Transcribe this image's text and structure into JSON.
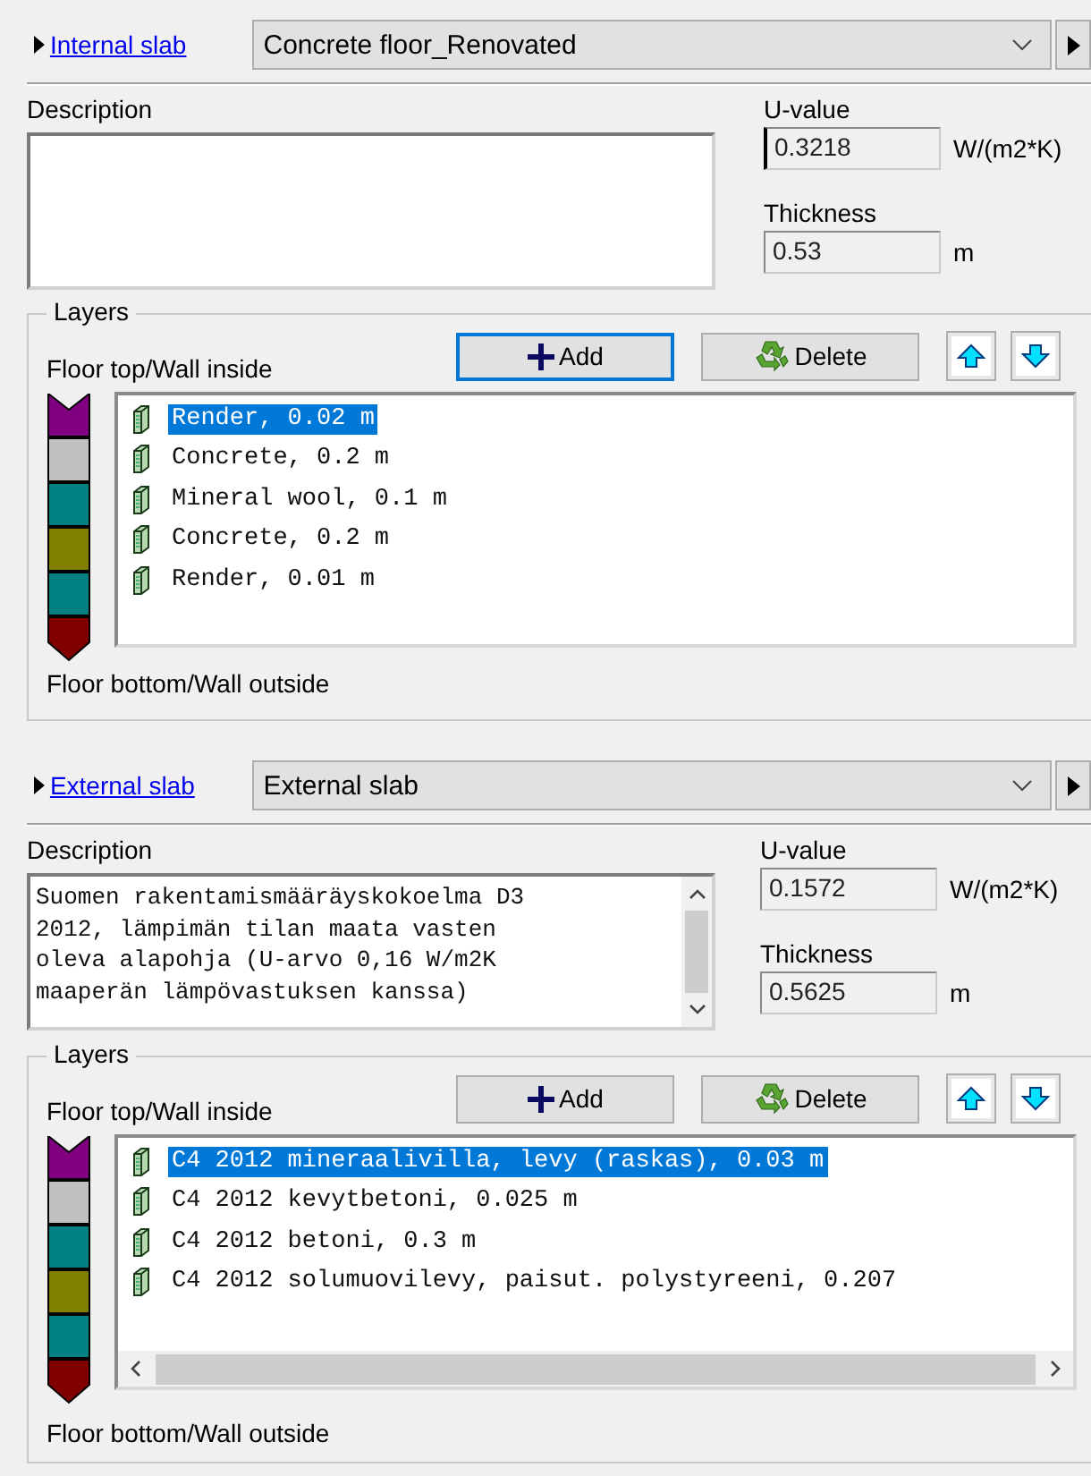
{
  "sections": [
    {
      "link": "Internal slab",
      "construction": "Concrete floor_Renovated",
      "description_label": "Description",
      "description_scroll": false,
      "u_value_label": "U-value",
      "u_value": "0.3218",
      "u_unit": "W/(m2*K)",
      "thickness_label": "Thickness",
      "thickness": "0.53",
      "thickness_unit": "m",
      "layers_title": "Layers",
      "top_label": "Floor top/Wall inside",
      "bottom_label": "Floor bottom/Wall outside",
      "add": "Add",
      "add_focused": true,
      "delete": "Delete",
      "h_scroll": false,
      "stack": [
        {
          "color": "#800080"
        },
        {
          "color": "#c0c0c0"
        },
        {
          "color": "#008080"
        },
        {
          "color": "#808000"
        },
        {
          "color": "#008080"
        },
        {
          "color": "#800000"
        }
      ],
      "layers": [
        {
          "name": "Render, 0.02 m",
          "selected": true
        },
        {
          "name": "Concrete, 0.2 m",
          "selected": false
        },
        {
          "name": "Mineral wool, 0.1 m",
          "selected": false
        },
        {
          "name": "Concrete, 0.2 m",
          "selected": false
        },
        {
          "name": "Render, 0.01 m",
          "selected": false
        }
      ]
    },
    {
      "link": "External slab",
      "construction": "External slab",
      "description_label": "Description",
      "description": "Suomen rakentamismääräyskokoelma D3 2012, lämpimän tilan maata vasten oleva alapohja (U-arvo 0,16 W/m2K maaperän lämpövastuksen kanssa)",
      "description_scroll": true,
      "u_value_label": "U-value",
      "u_value": "0.1572",
      "u_unit": "W/(m2*K)",
      "thickness_label": "Thickness",
      "thickness": "0.5625",
      "thickness_unit": "m",
      "layers_title": "Layers",
      "top_label": "Floor top/Wall inside",
      "bottom_label": "Floor bottom/Wall outside",
      "add": "Add",
      "add_focused": false,
      "delete": "Delete",
      "h_scroll": true,
      "stack": [
        {
          "color": "#800080"
        },
        {
          "color": "#c0c0c0"
        },
        {
          "color": "#008080"
        },
        {
          "color": "#808000"
        },
        {
          "color": "#008080"
        },
        {
          "color": "#800000"
        }
      ],
      "layers": [
        {
          "name": "C4 2012 mineraalivilla, levy (raskas), 0.03 m",
          "selected": true
        },
        {
          "name": "C4 2012 kevytbetoni, 0.025 m",
          "selected": false
        },
        {
          "name": "C4 2012 betoni, 0.3 m",
          "selected": false
        },
        {
          "name": "C4 2012 solumuovilevy, paisut. polystyreeni, 0.207",
          "selected": false
        }
      ]
    }
  ]
}
